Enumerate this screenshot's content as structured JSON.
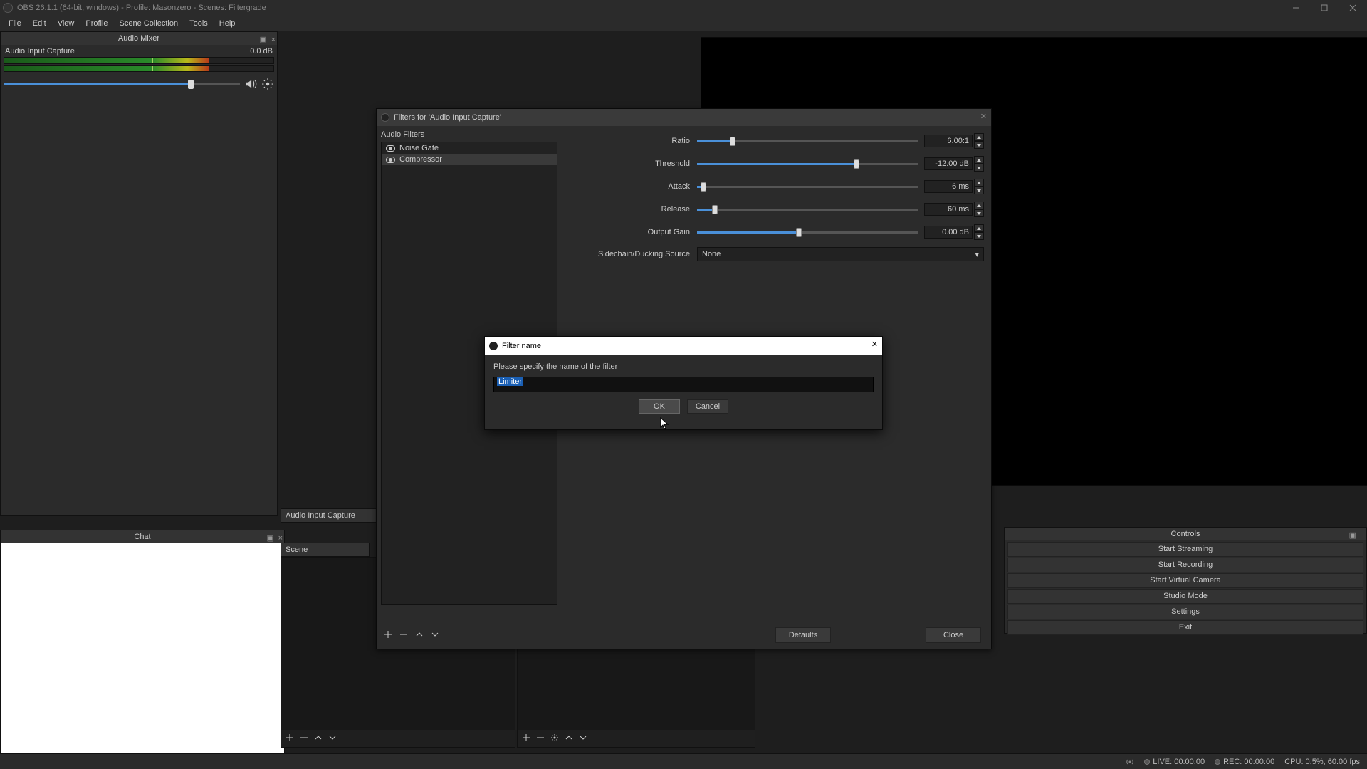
{
  "titlebar": {
    "text": "OBS 26.1.1 (64-bit, windows) - Profile: Masonzero - Scenes: Filtergrade"
  },
  "menubar": {
    "items": [
      "File",
      "Edit",
      "View",
      "Profile",
      "Scene Collection",
      "Tools",
      "Help"
    ]
  },
  "audio_mixer": {
    "title": "Audio Mixer",
    "channel": {
      "name": "Audio Input Capture",
      "level": "0.0 dB"
    }
  },
  "chat": {
    "title": "Chat"
  },
  "preview": {
    "source_label": "Audio Input Capture",
    "scene_label": "Scene"
  },
  "controls": {
    "title": "Controls",
    "buttons": [
      "Start Streaming",
      "Start Recording",
      "Start Virtual Camera",
      "Studio Mode",
      "Settings",
      "Exit"
    ]
  },
  "statusbar": {
    "live": "LIVE: 00:00:00",
    "rec": "REC: 00:00:00",
    "cpu": "CPU: 0.5%, 60.00 fps"
  },
  "filters_dialog": {
    "title": "Filters for 'Audio Input Capture'",
    "left_label": "Audio Filters",
    "filters": [
      "Noise Gate",
      "Compressor"
    ],
    "selected_index": 1,
    "params": {
      "ratio": {
        "label": "Ratio",
        "value": "6.00:1",
        "pct": 16
      },
      "threshold": {
        "label": "Threshold",
        "value": "-12.00 dB",
        "pct": 72
      },
      "attack": {
        "label": "Attack",
        "value": "6 ms",
        "pct": 3
      },
      "release": {
        "label": "Release",
        "value": "60 ms",
        "pct": 8
      },
      "output_gain": {
        "label": "Output Gain",
        "value": "0.00 dB",
        "pct": 46
      },
      "sidechain": {
        "label": "Sidechain/Ducking Source",
        "value": "None"
      }
    },
    "buttons": {
      "defaults": "Defaults",
      "close": "Close"
    }
  },
  "name_dialog": {
    "title": "Filter name",
    "prompt": "Please specify the name of the filter",
    "value": "Limiter",
    "ok": "OK",
    "cancel": "Cancel"
  }
}
